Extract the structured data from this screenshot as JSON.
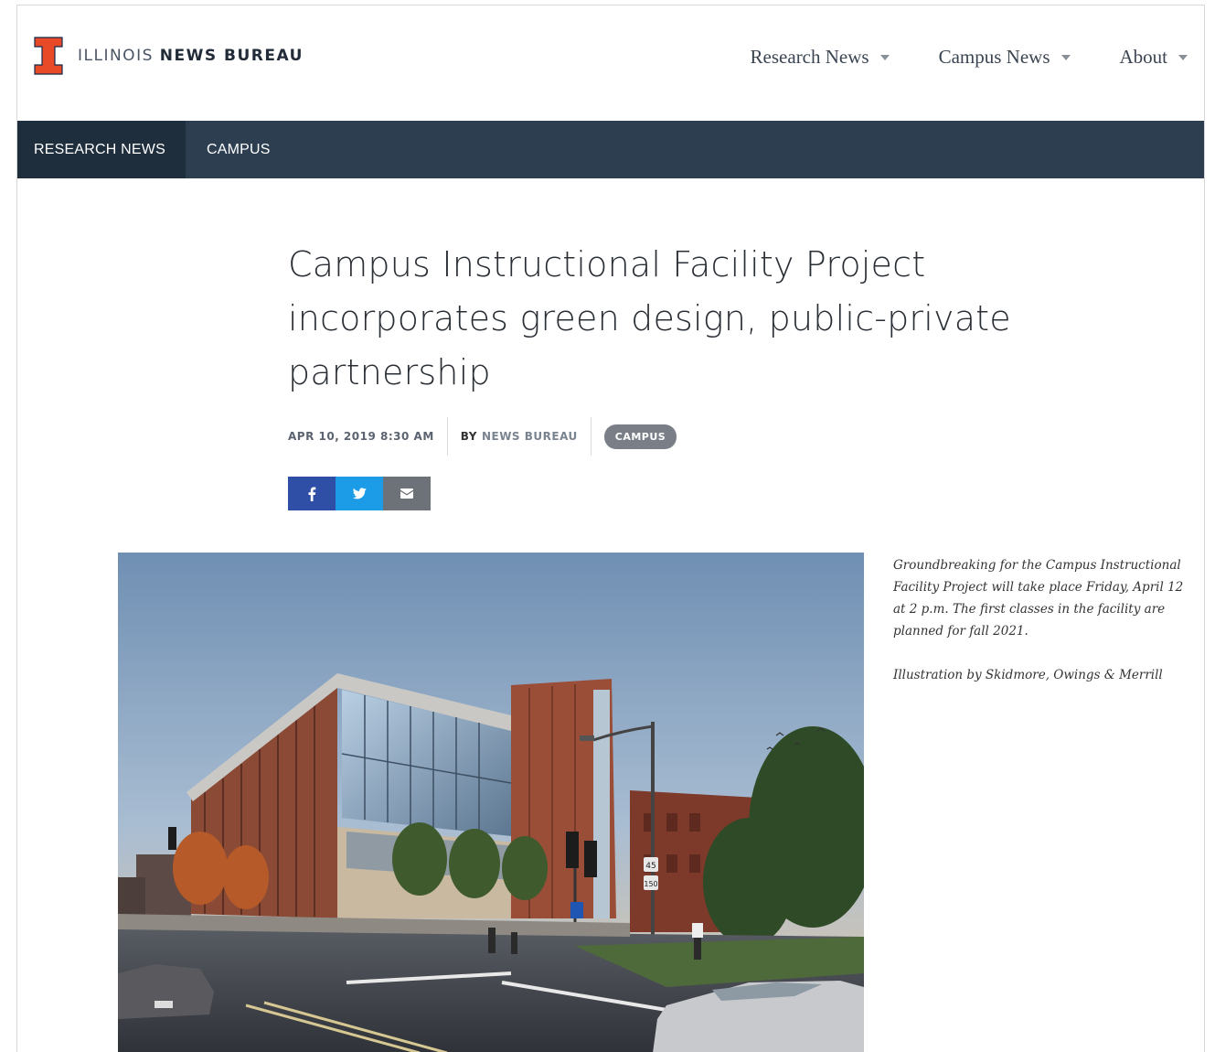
{
  "header": {
    "logo_light": "ILLINOIS",
    "logo_bold": "NEWS BUREAU",
    "nav": [
      {
        "label": "Research News"
      },
      {
        "label": "Campus News"
      },
      {
        "label": "About"
      }
    ]
  },
  "section_bar": {
    "items": [
      {
        "label": "RESEARCH NEWS",
        "active": true
      },
      {
        "label": "CAMPUS",
        "active": false
      }
    ]
  },
  "article": {
    "title": "Campus Instructional Facility Project incorporates green design, public-private partnership",
    "date": "APR 10, 2019 8:30 AM",
    "by_label": "BY",
    "author": "NEWS BUREAU",
    "tag": "CAMPUS",
    "share": [
      {
        "icon": "facebook-icon",
        "color": "#2f4fa6"
      },
      {
        "icon": "twitter-icon",
        "color": "#1c9ce6"
      },
      {
        "icon": "email-icon",
        "color": "#6d7178"
      }
    ],
    "caption_main": "Groundbreaking for the Campus Instructional Facility Project will take place Friday, April 12 at 2 p.m. The first classes in the facility are planned for fall 2021.",
    "caption_credit": "Illustration by Skidmore, Owings & Merrill",
    "image_signs": [
      "45",
      "150"
    ]
  },
  "colors": {
    "brand_orange": "#e84a27",
    "nav_bar": "#2c3e50",
    "nav_bar_active": "#1f2e3d"
  }
}
